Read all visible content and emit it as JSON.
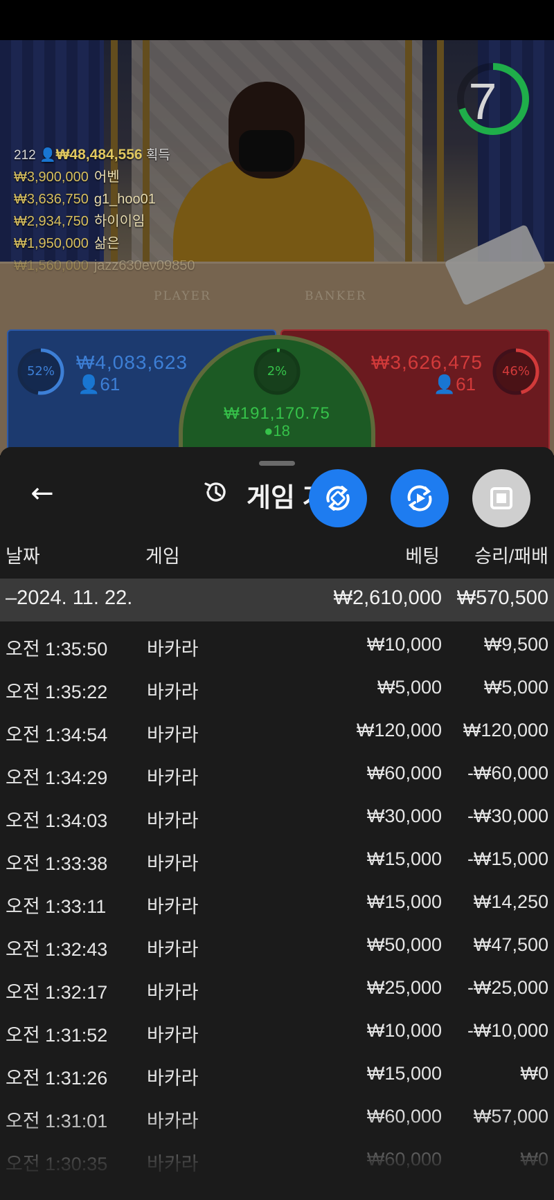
{
  "live": {
    "timer": "7",
    "timer_level": 0.7,
    "winners_head": {
      "count": "212",
      "amount": "₩48,484,556",
      "label": "획득"
    },
    "winners": [
      {
        "amount": "₩3,900,000",
        "name": "어벤"
      },
      {
        "amount": "₩3,636,750",
        "name": "g1_hoo01"
      },
      {
        "amount": "₩2,934,750",
        "name": "하이이임"
      },
      {
        "amount": "₩1,950,000",
        "name": "삶은"
      },
      {
        "amount": "₩1,560,000",
        "name": "jazz630ev09850"
      }
    ],
    "table_labels": {
      "player": "PLAYER",
      "banker": "BANKER"
    },
    "player": {
      "percent": "52%",
      "percent_value": 52,
      "amount": "₩4,083,623",
      "players": "61"
    },
    "banker": {
      "percent": "46%",
      "percent_value": 46,
      "amount": "₩3,626,475",
      "players": "61"
    },
    "tie": {
      "percent": "2%",
      "percent_value": 2,
      "amount": "₩191,170.75",
      "players": "18"
    }
  },
  "sheet": {
    "back_icon": "arrow-left-icon",
    "history_icon": "history-icon",
    "title": "게임 기록",
    "fab_icons": [
      "rotate-icon",
      "play-rotate-icon",
      "stop-icon"
    ]
  },
  "table": {
    "headers": {
      "date": "날짜",
      "game": "게임",
      "bet": "베팅",
      "result": "승리/패배"
    },
    "date_group": {
      "label": "–2024. 11. 22.",
      "bet": "₩2,610,000",
      "result": "₩570,500"
    },
    "rows": [
      {
        "time": "오전 1:35:50",
        "game": "바카라",
        "bet": "₩10,000",
        "result": "₩9,500"
      },
      {
        "time": "오전 1:35:22",
        "game": "바카라",
        "bet": "₩5,000",
        "result": "₩5,000"
      },
      {
        "time": "오전 1:34:54",
        "game": "바카라",
        "bet": "₩120,000",
        "result": "₩120,000"
      },
      {
        "time": "오전 1:34:29",
        "game": "바카라",
        "bet": "₩60,000",
        "result": "-₩60,000"
      },
      {
        "time": "오전 1:34:03",
        "game": "바카라",
        "bet": "₩30,000",
        "result": "-₩30,000"
      },
      {
        "time": "오전 1:33:38",
        "game": "바카라",
        "bet": "₩15,000",
        "result": "-₩15,000"
      },
      {
        "time": "오전 1:33:11",
        "game": "바카라",
        "bet": "₩15,000",
        "result": "₩14,250"
      },
      {
        "time": "오전 1:32:43",
        "game": "바카라",
        "bet": "₩50,000",
        "result": "₩47,500"
      },
      {
        "time": "오전 1:32:17",
        "game": "바카라",
        "bet": "₩25,000",
        "result": "-₩25,000"
      },
      {
        "time": "오전 1:31:52",
        "game": "바카라",
        "bet": "₩10,000",
        "result": "-₩10,000"
      },
      {
        "time": "오전 1:31:26",
        "game": "바카라",
        "bet": "₩15,000",
        "result": "₩0"
      },
      {
        "time": "오전 1:31:01",
        "game": "바카라",
        "bet": "₩60,000",
        "result": "₩57,000"
      },
      {
        "time": "오전 1:30:35",
        "game": "바카라",
        "bet": "₩60,000",
        "result": "₩0"
      }
    ]
  },
  "colors": {
    "blue": "#1e7cf0",
    "player_text": "#3d7fd6",
    "banker_text": "#d23a3a",
    "tie_text": "#36c24a",
    "timer_ring": "#1fae4a"
  }
}
